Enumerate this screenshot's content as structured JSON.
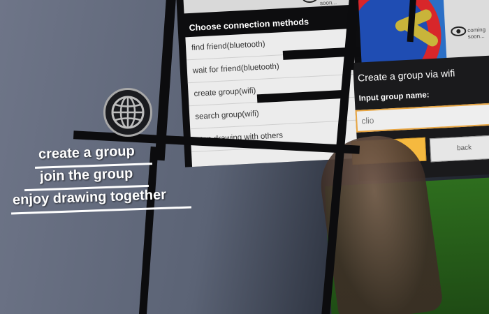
{
  "connection_menu": {
    "header": "Choose connection methods",
    "items": [
      "find friend(bluetooth)",
      "wait for friend(bluetooth)",
      "create group(wifi)",
      "search group(wifi)",
      "stop drawing with others"
    ],
    "status_text": "coming soon..."
  },
  "create_group_dialog": {
    "title": "Create a group via wifi",
    "input_label": "Input group name:",
    "input_value": "clio",
    "ok_label": "",
    "back_label": "back"
  },
  "thumbnail": {
    "status_text": "coming soon..."
  },
  "tagline": [
    "create a group",
    "join the group",
    "enjoy drawing together"
  ],
  "colors": {
    "background": "#5f6778",
    "accent": "#f5b93f",
    "canvas_green": "#2e6e1e"
  },
  "icons": [
    "globe-icon",
    "eye-icon"
  ]
}
